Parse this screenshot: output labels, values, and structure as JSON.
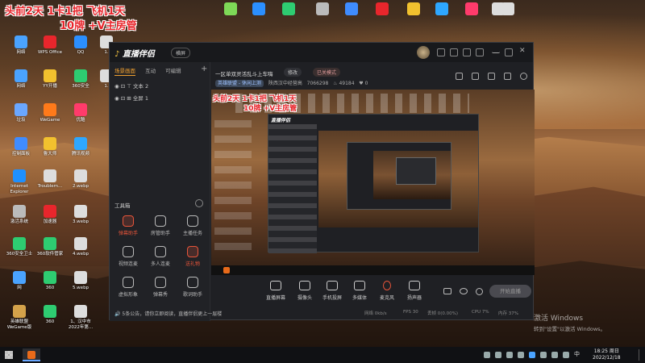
{
  "overlay": {
    "line1": "头前2天  1卡1把  飞机1天",
    "line2": "10牌  +V主房管"
  },
  "desktop_icons": [
    {
      "label": "网络",
      "color": "#4aa3ff"
    },
    {
      "label": "WPS Office",
      "color": "#e8262c"
    },
    {
      "label": "QQ",
      "color": "#2b8fff"
    },
    {
      "label": "1.",
      "color": "#dddddd"
    },
    {
      "label": "网络",
      "color": "#4aa3ff"
    },
    {
      "label": "YY开播",
      "color": "#f2c12e"
    },
    {
      "label": "360安全",
      "color": "#2ecc71"
    },
    {
      "label": "1.",
      "color": "#dddddd"
    },
    {
      "label": "垃圾",
      "color": "#6aa7ff"
    },
    {
      "label": "WeGame",
      "color": "#ff7a1a"
    },
    {
      "label": "优酷",
      "color": "#ff3b6b"
    },
    {
      "label": "控制面板",
      "color": "#3f8cff"
    },
    {
      "label": "鲁大师",
      "color": "#f2c12e"
    },
    {
      "label": "腾讯视频",
      "color": "#2ea7ff"
    },
    {
      "label": "Internet Explorer",
      "color": "#1e90ff"
    },
    {
      "label": "Troublem...",
      "color": "#dddddd"
    },
    {
      "label": "2.webp",
      "color": "#dddddd"
    },
    {
      "label": "激活系统",
      "color": "#bbbbbb"
    },
    {
      "label": "加速器",
      "color": "#e8262c"
    },
    {
      "label": "3.webp",
      "color": "#dddddd"
    },
    {
      "label": "360安全卫士",
      "color": "#2ecc71"
    },
    {
      "label": "360软件管家",
      "color": "#2ecc71"
    },
    {
      "label": "4.webp",
      "color": "#dddddd"
    },
    {
      "label": "网",
      "color": "#4aa3ff"
    },
    {
      "label": "360",
      "color": "#2ecc71"
    },
    {
      "label": "5.webp",
      "color": "#dddddd"
    },
    {
      "label": "英雄联盟 WeGame版",
      "color": "#d4a24a"
    },
    {
      "label": "360",
      "color": "#2ecc71"
    },
    {
      "label": "1、汉中市 2022年第...",
      "color": "#dddddd"
    }
  ],
  "top_icons": [
    {
      "label": "",
      "color": "#7ed957"
    },
    {
      "label": "",
      "color": "#2b8fff"
    },
    {
      "label": "",
      "color": "#2ecc71"
    },
    {
      "label": "",
      "color": "#bbbbbb"
    },
    {
      "label": "",
      "color": "#3f8cff"
    },
    {
      "label": "",
      "color": "#e8262c"
    },
    {
      "label": "",
      "color": "#f2c12e"
    },
    {
      "label": "",
      "color": "#2ea7ff"
    },
    {
      "label": "",
      "color": "#ff3b6b"
    },
    {
      "label": "",
      "color": "#dddddd"
    },
    {
      "label": "",
      "color": "#dddddd"
    }
  ],
  "window": {
    "app_name": "直播伴侣",
    "mode_button": "横屏",
    "left_tabs": [
      "场景画面",
      "互动",
      "可编辑"
    ],
    "sources": [
      "文本 2",
      "全屏 1"
    ],
    "tools_label": "工具箱",
    "tools": [
      {
        "label": "弹幕助手",
        "highlight": true
      },
      {
        "label": "房管助手",
        "highlight": false
      },
      {
        "label": "主播任务",
        "highlight": false
      },
      {
        "label": "视频连麦",
        "highlight": false
      },
      {
        "label": "多人连麦",
        "highlight": false
      },
      {
        "label": "送礼物",
        "highlight": true
      },
      {
        "label": "虚拟形象",
        "highlight": false
      },
      {
        "label": "弹幕秀",
        "highlight": false
      },
      {
        "label": "歌词助手",
        "highlight": false
      }
    ],
    "notice": "5条公告，请你立即阅读，直播伴侣更上一层楼",
    "room_title": "一区单双灵活乱斗上车嗨",
    "edit_chip": "修改",
    "mode_chip": "已关模式",
    "category_badge": "英雄联盟 - 休闲上测",
    "location": "陕西汉中经营高",
    "room_id": "7066298",
    "viewer_count": "49184",
    "likes": "0",
    "preview_overlay1": "头前2天  1卡1把  飞机1天",
    "preview_overlay2": "10牌  +V主房管",
    "bottom_tools": [
      "直播屏幕",
      "摄像头",
      "手机投屏",
      "多媒体",
      "麦克风",
      "扬声器"
    ],
    "start_button": "开始直播",
    "status": {
      "net": "网络 0kb/s",
      "fps": "FPS 30",
      "loss": "丢帧 0(0.00%)",
      "cpu": "CPU 7%",
      "mem": "内存 37%"
    }
  },
  "activation": {
    "line1": "激活 Windows",
    "line2": "转到\"设置\"以激活 Windows。"
  },
  "taskbar": {
    "time": "18:25 周日",
    "date": "2022/12/18"
  }
}
